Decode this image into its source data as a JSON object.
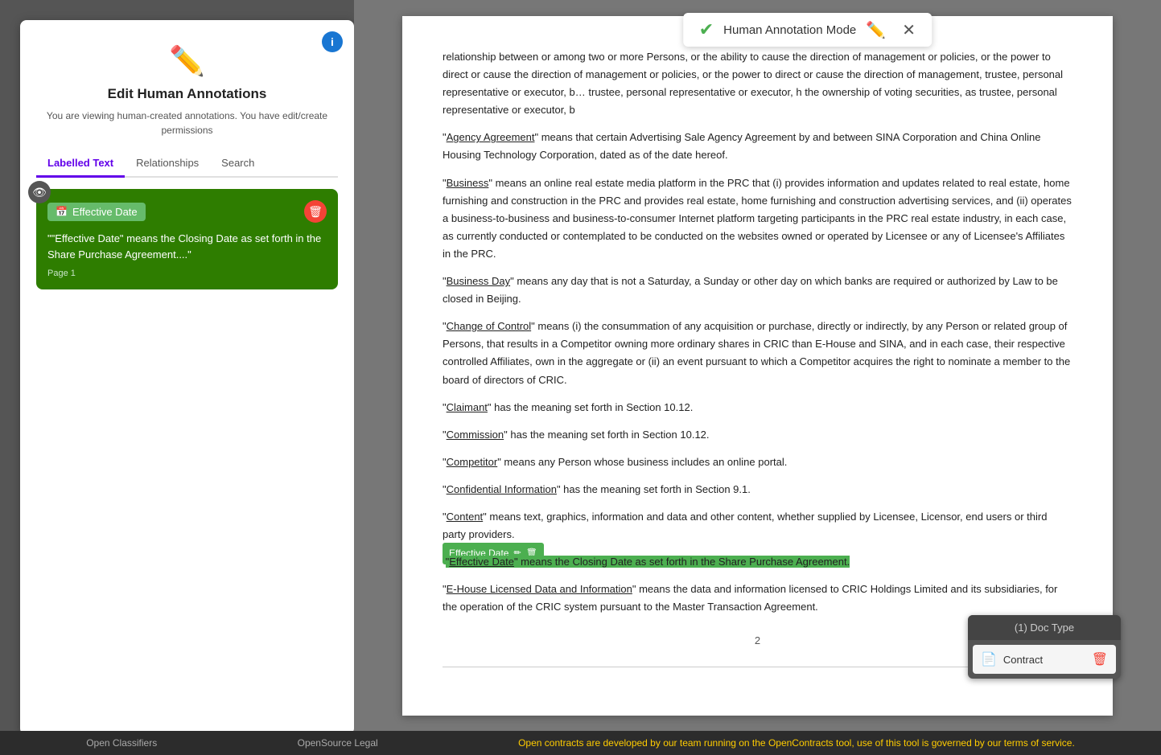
{
  "app": {
    "title": "Edit Human Annotations"
  },
  "left_panel": {
    "info_badge": "i",
    "edit_icon": "✏️",
    "title": "Edit Human Annotations",
    "subtitle": "You are viewing human-created annotations. You have edit/create permissions",
    "tabs": [
      {
        "id": "labelled-text",
        "label": "Labelled Text",
        "active": true
      },
      {
        "id": "relationships",
        "label": "Relationships",
        "active": false
      },
      {
        "id": "search",
        "label": "Search",
        "active": false
      }
    ],
    "annotation_card": {
      "label": "Effective Date",
      "text": "\"\"Effective Date\" means the Closing Date as set forth in the Share Purchase Agreement....\"",
      "page": "Page 1"
    }
  },
  "ham_banner": {
    "text": "Human Annotation Mode"
  },
  "document": {
    "paragraphs": [
      {
        "id": "p1",
        "text": "relationship between or among two or more Persons, or the ability to cause the direction of management or policies, or the power to direct or cause the direction of management or policies, or the power to direct or cause the direction of management, trustee, personal representative or executor, b... trustee, personal representative or executor, h the ownership of voting securities, as trustee, personal representative or executor, b"
      },
      {
        "id": "p2",
        "term": "Agency Agreement",
        "text_before": "“",
        "term_text": "Agency Agreement",
        "text_after": "” means that certain Advertising Sale Agency Agreement by and between SINA Corporation and China Online Housing Technology Corporation, dated as of the date hereof."
      },
      {
        "id": "p3",
        "term": "Business",
        "text_before": "“",
        "term_text": "Business",
        "text_after": "” means an online real estate media platform in the PRC that (i) provides information and updates related to real estate, home furnishing and construction in the PRC and provides real estate, home furnishing and construction advertising services, and (ii) operates a business-to-business and business-to-consumer Internet platform targeting participants in the PRC real estate industry, in each case, as currently conducted or contemplated to be conducted on the websites owned or operated by Licensee or any of Licensee’s Affiliates in the PRC."
      },
      {
        "id": "p4",
        "term": "Business Day",
        "text_before": "“",
        "term_text": "Business Day",
        "text_after": "” means any day that is not a Saturday, a Sunday or other day on which banks are required or authorized by Law to be closed in Beijing."
      },
      {
        "id": "p5",
        "term": "Change of Control",
        "text_before": "“",
        "term_text": "Change of Control",
        "text_after": "” means (i) the consummation of any acquisition or purchase, directly or indirectly, by any Person or related group of Persons, that results in a Competitor owning more ordinary shares in CRIC than E-House and SINA, and in each case, their respective controlled Affiliates, own in the aggregate or (ii) an event pursuant to which a Competitor acquires the right to nominate a member to the board of directors of CRIC."
      },
      {
        "id": "p6",
        "term": "Claimant",
        "text_before": "“",
        "term_text": "Claimant",
        "text_after": "” has the meaning set forth in Section 10.12."
      },
      {
        "id": "p7",
        "term": "Commission",
        "text_before": "“",
        "term_text": "Commission",
        "text_after": "” has the meaning set forth in Section 10.12."
      },
      {
        "id": "p8",
        "term": "Competitor",
        "text_before": "“",
        "term_text": "Competitor",
        "text_after": "” means any Person whose business includes an online portal."
      },
      {
        "id": "p9",
        "term": "Confidential Information",
        "text_before": "“",
        "term_text": "Confidential Information",
        "text_after": "” has the meaning set forth in Section 9.1."
      },
      {
        "id": "p10",
        "term": "Content",
        "text_before": "“",
        "term_text": "Content",
        "text_after": "” means text, graphics, information and data and other content, whether supplied by Licensee, Licensor, end users or third party providers."
      },
      {
        "id": "p11",
        "highlighted": true,
        "annotation_label": "Effective Date",
        "term": "Effective Date",
        "text_before": "“",
        "term_text": "Effective Date",
        "text_after": "” means the Closing Date as set forth in the Share Purchase Agreement."
      },
      {
        "id": "p12",
        "term": "E-House Licensed Data and Information",
        "text_before": "“",
        "term_text": "E-House Licensed Data and Information",
        "text_after": "” means the data and information licensed to CRIC Holdings Limited and its subsidiaries, for the operation of the CRIC system pursuant to the Master Transaction Agreement."
      }
    ],
    "page_num": "2"
  },
  "doctype_panel": {
    "header": "(1) Doc Type",
    "item_label": "Contract"
  },
  "footer": {
    "links": [
      {
        "label": "Open Classifiers",
        "highlight": false
      },
      {
        "label": "OpenSource Legal",
        "highlight": false
      },
      {
        "label": "Open contracts are developed by our team running on the OpenContracts tool, use of this tool is governed by our terms of service.",
        "highlight": true
      }
    ]
  },
  "icons": {
    "pencil": "✏",
    "eye": "👁",
    "trash": "🗑",
    "calendar": "📅",
    "document": "📄",
    "checkmark": "✔",
    "edit": "✏",
    "close": "✕"
  }
}
